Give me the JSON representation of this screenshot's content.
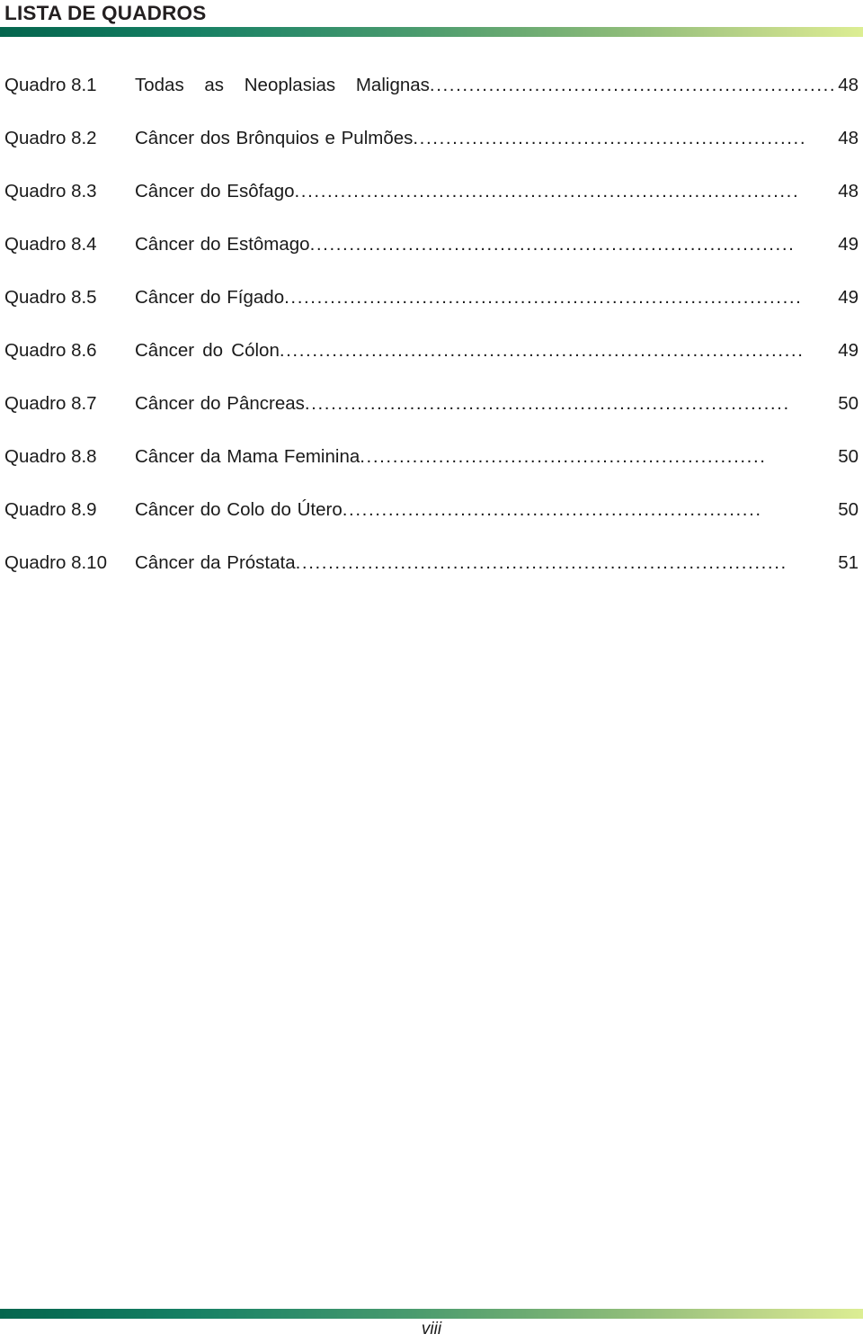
{
  "header": {
    "title": "LISTA DE QUADROS",
    "rule_gradient_start": "#05664e",
    "rule_gradient_end": "#dcee93"
  },
  "list": {
    "entries": [
      {
        "label": "Quadro 8.1",
        "title": "Todas as Neoplasias Malignas",
        "leader": "......................................................................",
        "page": "48"
      },
      {
        "label": "Quadro 8.2",
        "title": "Câncer dos Brônquios e Pulmões",
        "leader": "............................................................",
        "page": "48"
      },
      {
        "label": "Quadro 8.3",
        "title": "Câncer do Esôfago",
        "leader": ".............................................................................",
        "page": "48"
      },
      {
        "label": "Quadro 8.4",
        "title": "Câncer do Estômago",
        "leader": "..........................................................................",
        "page": "49"
      },
      {
        "label": "Quadro 8.5",
        "title": "Câncer do Fígado",
        "leader": "...............................................................................",
        "page": "49"
      },
      {
        "label": "Quadro 8.6",
        "title": "Câncer do Cólon",
        "leader": "................................................................................",
        "page": "49"
      },
      {
        "label": "Quadro 8.7",
        "title": "Câncer do Pâncreas",
        "leader": "..........................................................................",
        "page": "50"
      },
      {
        "label": "Quadro 8.8",
        "title": "Câncer da Mama Feminina",
        "leader": "..............................................................",
        "page": "50"
      },
      {
        "label": "Quadro 8.9",
        "title": "Câncer do Colo do Útero",
        "leader": "................................................................",
        "page": "50"
      },
      {
        "label": "Quadro 8.10",
        "title": "Câncer da Próstata",
        "leader": "...........................................................................",
        "page": "51"
      }
    ]
  },
  "footer": {
    "page_number": "viii",
    "rule_gradient_start": "#05664e",
    "rule_gradient_end": "#dcee93"
  }
}
